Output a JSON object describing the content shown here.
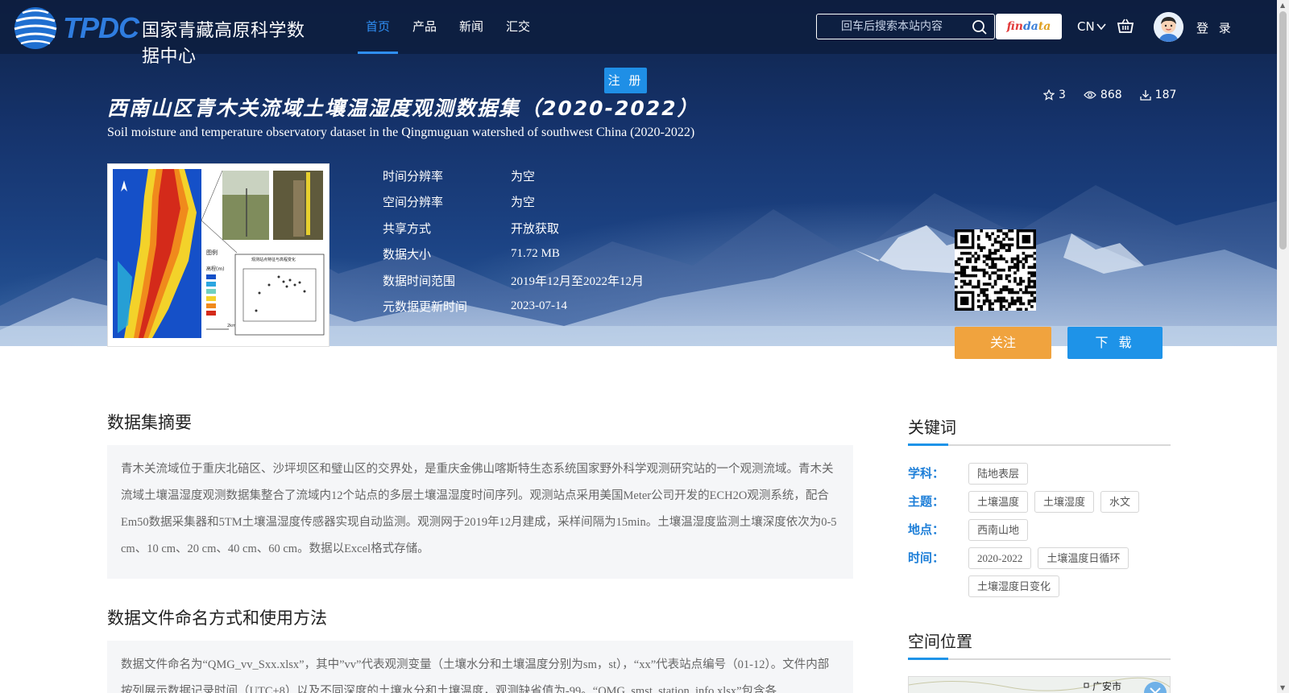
{
  "header": {
    "logo_abbr": "TPDC",
    "logo_name": "国家青藏高原科学数据中心",
    "nav": [
      {
        "label": "首页",
        "active": true
      },
      {
        "label": "产品",
        "active": false
      },
      {
        "label": "新闻",
        "active": false
      },
      {
        "label": "汇交",
        "active": false
      }
    ],
    "search_placeholder": "回车后搜索本站内容",
    "findata_parts": [
      "fin",
      "da",
      "ta"
    ],
    "lang": "CN",
    "login": "登 录",
    "register": "注 册",
    "accent_color": "#2f8ff5"
  },
  "dataset": {
    "title_zh": "西南山区青木关流域土壤温湿度观测数据集（2020-2022）",
    "title_en": "Soil moisture and temperature observatory dataset in the Qingmuguan watershed of southwest China (2020-2022)",
    "stats": {
      "stars": "3",
      "views": "868",
      "downloads": "187"
    },
    "meta": [
      {
        "label": "时间分辨率",
        "value": "为空"
      },
      {
        "label": "空间分辨率",
        "value": "为空"
      },
      {
        "label": "共享方式",
        "value": "开放获取"
      },
      {
        "label": "数据大小",
        "value": "71.72 MB"
      },
      {
        "label": "数据时间范围",
        "value": "2019年12月至2022年12月"
      },
      {
        "label": "元数据更新时间",
        "value": "2023-07-14"
      }
    ],
    "follow": "关注",
    "download": "下 载"
  },
  "thumbnail": {
    "legend_title": "图例",
    "elevation_label": "高程(m)",
    "scatter_title": "观测站点特征与高程变化",
    "scale_label": "2km"
  },
  "abstract": {
    "title": "数据集摘要",
    "text": "青木关流域位于重庆北碚区、沙坪坝区和璧山区的交界处，是重庆金佛山喀斯特生态系统国家野外科学观测研究站的一个观测流域。青木关流域土壤温湿度观测数据集整合了流域内12个站点的多层土壤温湿度时间序列。观测站点采用美国Meter公司开发的ECH2O观测系统，配合Em50数据采集器和5TM土壤温湿度传感器实现自动监测。观测网于2019年12月建成，采样间隔为15min。土壤温湿度监测土壤深度依次为0-5 cm、10 cm、20 cm、40 cm、60 cm。数据以Excel格式存储。"
  },
  "file_naming": {
    "title": "数据文件命名方式和使用方法",
    "text": "数据文件命名为“QMG_vv_Sxx.xlsx”，其中”vv”代表观测变量（土壤水分和土壤温度分别为sm，st），“xx”代表站点编号（01-12）。文件内部按列展示数据记录时间（UTC+8）以及不同深度的土壤水分和土壤温度，观测缺省值为-99。“QMG_smst_station_info.xlsx”包含各"
  },
  "keywords": {
    "title": "关键词",
    "groups": [
      {
        "label": "学科：",
        "tags": [
          "陆地表层"
        ]
      },
      {
        "label": "主题：",
        "tags": [
          "土壤温度",
          "土壤湿度",
          "水文"
        ]
      },
      {
        "label": "地点：",
        "tags": [
          "西南山地"
        ]
      },
      {
        "label": "时间：",
        "tags": [
          "2020-2022",
          "土壤温度日循环",
          "土壤湿度日变化"
        ]
      }
    ]
  },
  "location": {
    "title": "空间位置",
    "map_label": "广安市"
  }
}
